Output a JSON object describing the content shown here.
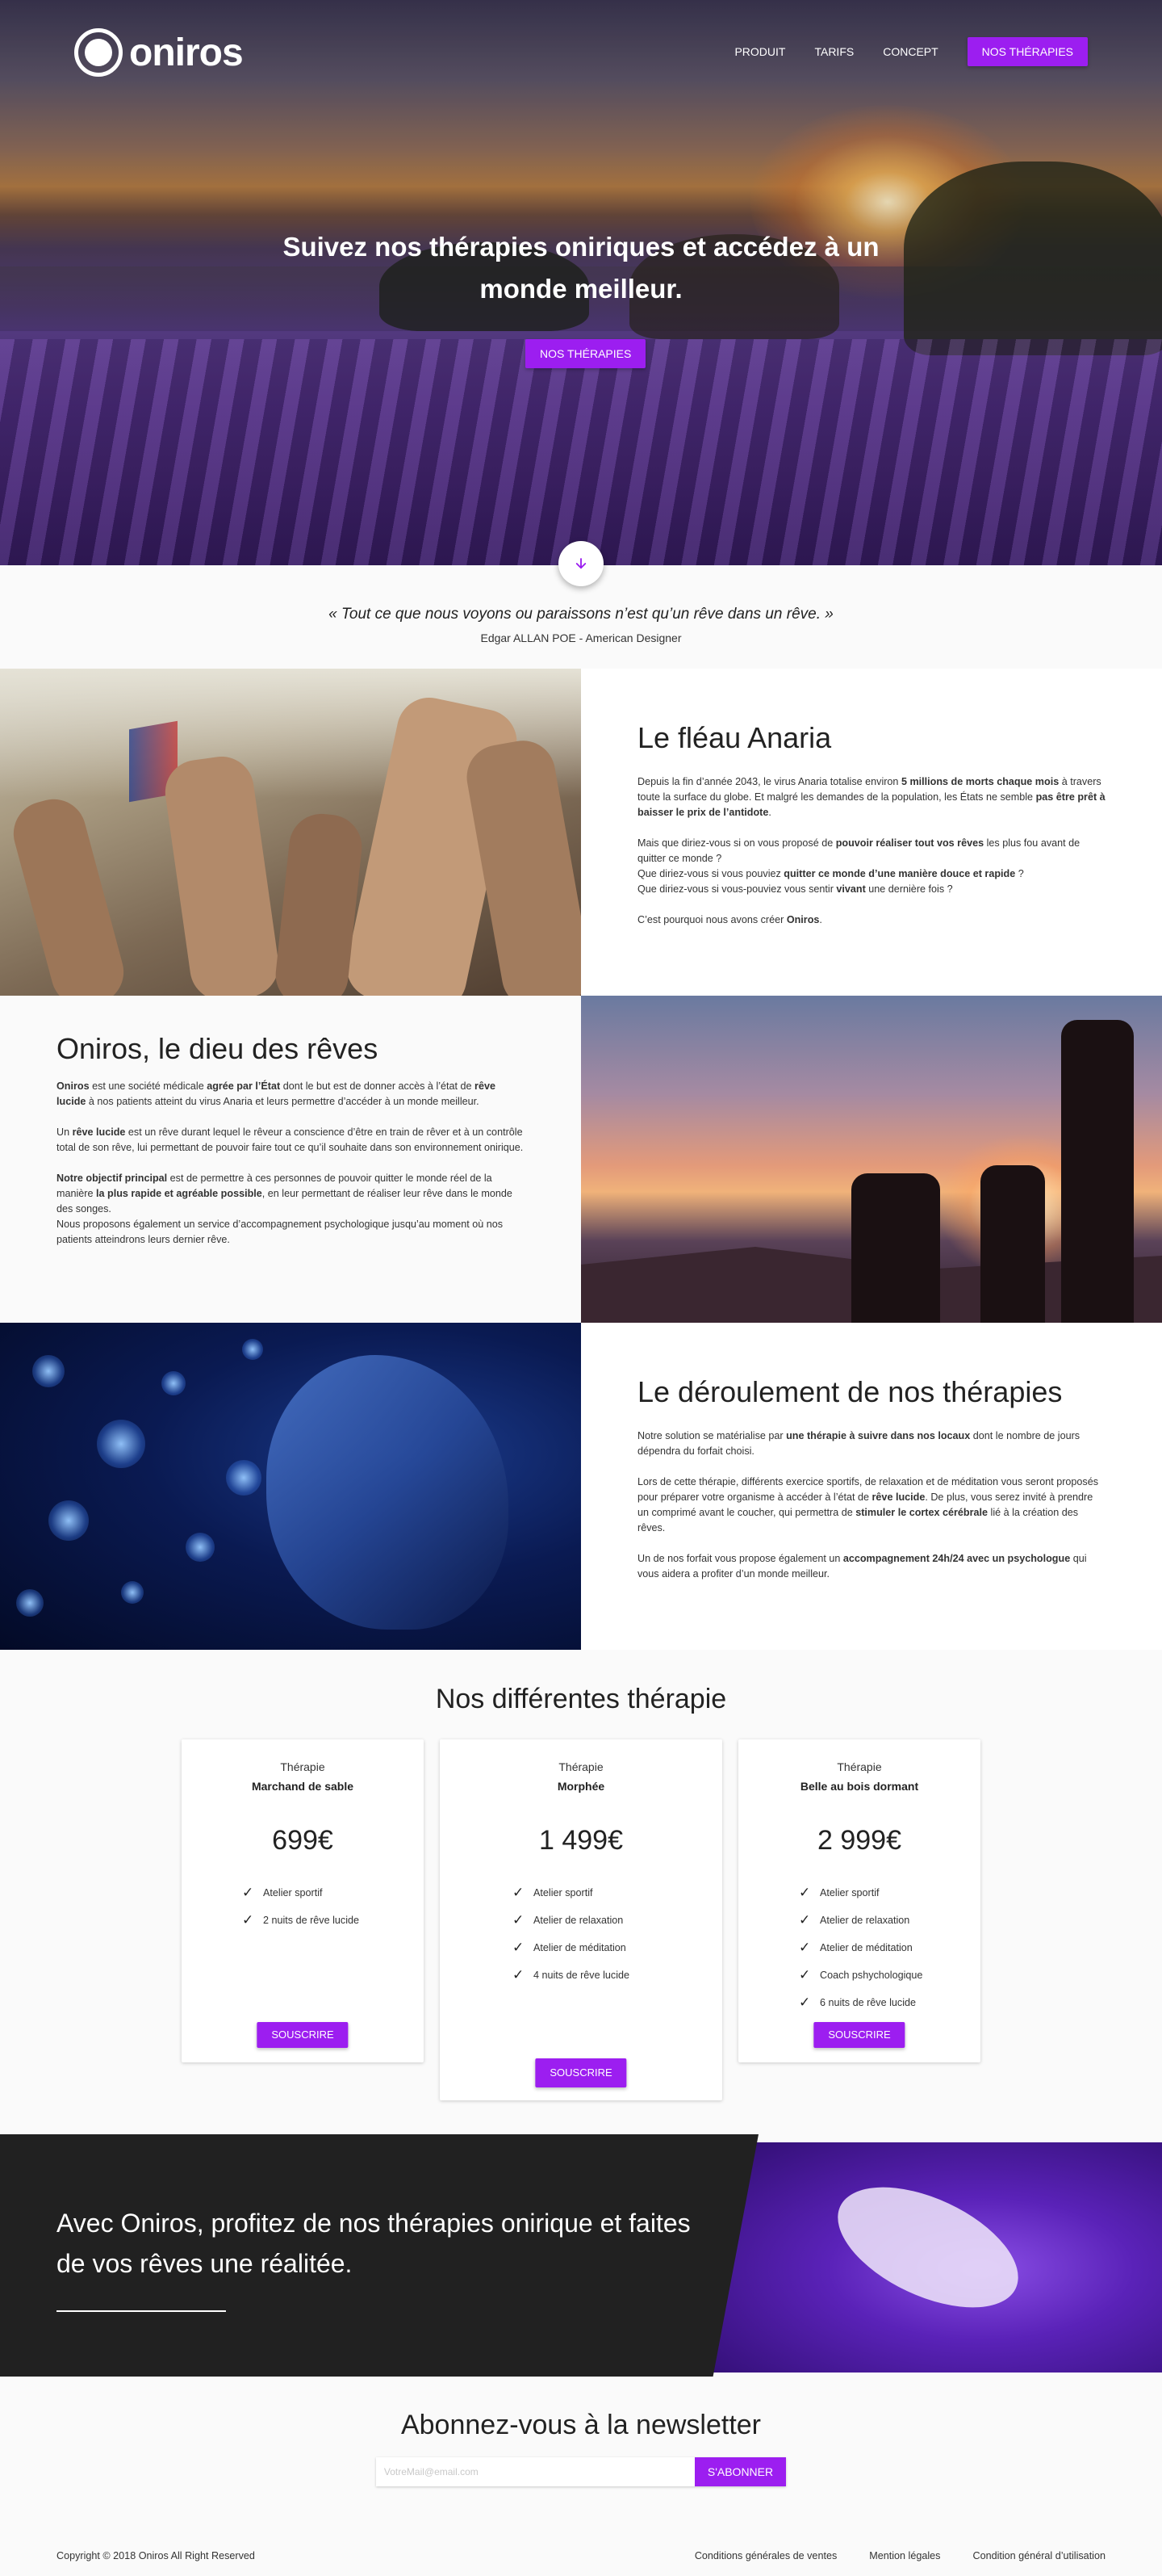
{
  "brand": {
    "name": "oniros"
  },
  "nav": {
    "links": [
      "PRODUIT",
      "TARIFS",
      "CONCEPT"
    ],
    "cta": "NOS THÉRAPIES"
  },
  "hero": {
    "title": "Suivez nos thérapies oniriques et accédez à un monde meilleur.",
    "cta": "NOS THÉRAPIES"
  },
  "quote": {
    "text": "« Tout ce que nous voyons ou paraissons n’est qu’un rêve dans un rêve. »",
    "author": "Edgar ALLAN POE - American Designer"
  },
  "sections": {
    "anaria": {
      "title": "Le fléau Anaria",
      "p1_a": "Depuis la fin d’année 2043, le virus Anaria totalise environ ",
      "p1_b": "5 millions de morts chaque mois",
      "p1_c": " à travers toute la surface du globe. Et malgré les demandes de la population, les États ne semble ",
      "p1_d": "pas être prêt à baisser le prix de l’antidote",
      "p1_e": ".",
      "p2_a": "Mais que diriez-vous si on vous proposé de ",
      "p2_b": "pouvoir réaliser tout vos rêves",
      "p2_c": " les plus fou avant de quitter ce monde ?",
      "p2_d": "Que diriez-vous si vous pouviez ",
      "p2_e": "quitter ce monde d’une manière douce et rapide",
      "p2_f": " ?",
      "p2_g": "Que diriez-vous si vous-pouviez vous sentir ",
      "p2_h": "vivant",
      "p2_i": " une dernière fois ?",
      "p3_a": "C’est pourquoi nous avons créer ",
      "p3_b": "Oniros",
      "p3_c": "."
    },
    "oniros": {
      "title": "Oniros, le dieu des rêves",
      "p1_a": "Oniros",
      "p1_b": " est une société médicale ",
      "p1_c": "agrée par l’État",
      "p1_d": " dont le but est de donner accès à l’état de ",
      "p1_e": "rêve lucide",
      "p1_f": " à nos patients atteint du virus Anaria et leurs permettre d’accéder à un monde meilleur.",
      "p2_a": "Un ",
      "p2_b": "rêve lucide",
      "p2_c": " est un rêve durant lequel le rêveur a conscience d’être en train de rêver et à un contrôle total de son rêve, lui permettant de pouvoir faire tout ce qu’il souhaite dans son environnement onirique.",
      "p3_a": "Notre objectif principal",
      "p3_b": " est de permettre à ces personnes de pouvoir quitter le monde réel de la manière ",
      "p3_c": "la plus rapide et agréable possible",
      "p3_d": ", en leur permettant de réaliser leur rêve dans le monde des songes.",
      "p3_e": "Nous proposons également un service d’accompagnement psychologique jusqu’au moment où nos patients atteindrons leurs dernier rêve."
    },
    "deroulement": {
      "title": "Le déroulement de nos thérapies",
      "p1_a": "Notre solution se matérialise par ",
      "p1_b": "une thérapie à suivre dans nos locaux",
      "p1_c": " dont le nombre de jours dépendra du forfait choisi.",
      "p2_a": "Lors de cette thérapie, différents exercice sportifs, de relaxation et de méditation vous seront proposés pour préparer votre organisme à accéder à l’état de ",
      "p2_b": "rêve lucide",
      "p2_c": ". De plus, vous serez invité à prendre un comprimé avant le coucher, qui permettra de ",
      "p2_d": "stimuler le cortex cérébrale",
      "p2_e": " lié à la création des rêves.",
      "p3_a": "Un de nos forfait vous propose également un ",
      "p3_b": "accompagnement 24h/24 avec un psychologue",
      "p3_c": " qui vous aidera a profiter d’un monde meilleur."
    }
  },
  "pricing": {
    "title": "Nos différentes thérapie",
    "plans": [
      {
        "label": "Thérapie",
        "name": "Marchand de sable",
        "price": "699€",
        "features": [
          "Atelier sportif",
          "2 nuits de rêve lucide"
        ],
        "button": "SOUSCRIRE"
      },
      {
        "label": "Thérapie",
        "name": "Morphée",
        "price": "1 499€",
        "features": [
          "Atelier sportif",
          "Atelier de relaxation",
          "Atelier de méditation",
          "4 nuits de rêve lucide"
        ],
        "button": "SOUSCRIRE"
      },
      {
        "label": "Thérapie",
        "name": "Belle au bois dormant",
        "price": "2 999€",
        "features": [
          "Atelier sportif",
          "Atelier de relaxation",
          "Atelier de méditation",
          "Coach pshychologique",
          "6 nuits de rêve lucide"
        ],
        "button": "SOUSCRIRE"
      }
    ]
  },
  "cta_banner": {
    "title": "Avec Oniros, profitez de nos thérapies onirique et faites de vos rêves une réalitée."
  },
  "newsletter": {
    "title": "Abonnez-vous à la newsletter",
    "placeholder": "VotreMail@email.com",
    "button": "S'ABONNER"
  },
  "footer": {
    "copyright": "Copyright © 2018 Oniros All Right Reserved",
    "links": [
      "Conditions générales de ventes",
      "Mention légales",
      "Condition général d’utilisation"
    ]
  },
  "colors": {
    "accent": "#9c1ef0",
    "dark": "#212121",
    "background": "#fafafa"
  },
  "icons": {
    "scroll": "arrow-down-icon",
    "check": "check-icon"
  }
}
